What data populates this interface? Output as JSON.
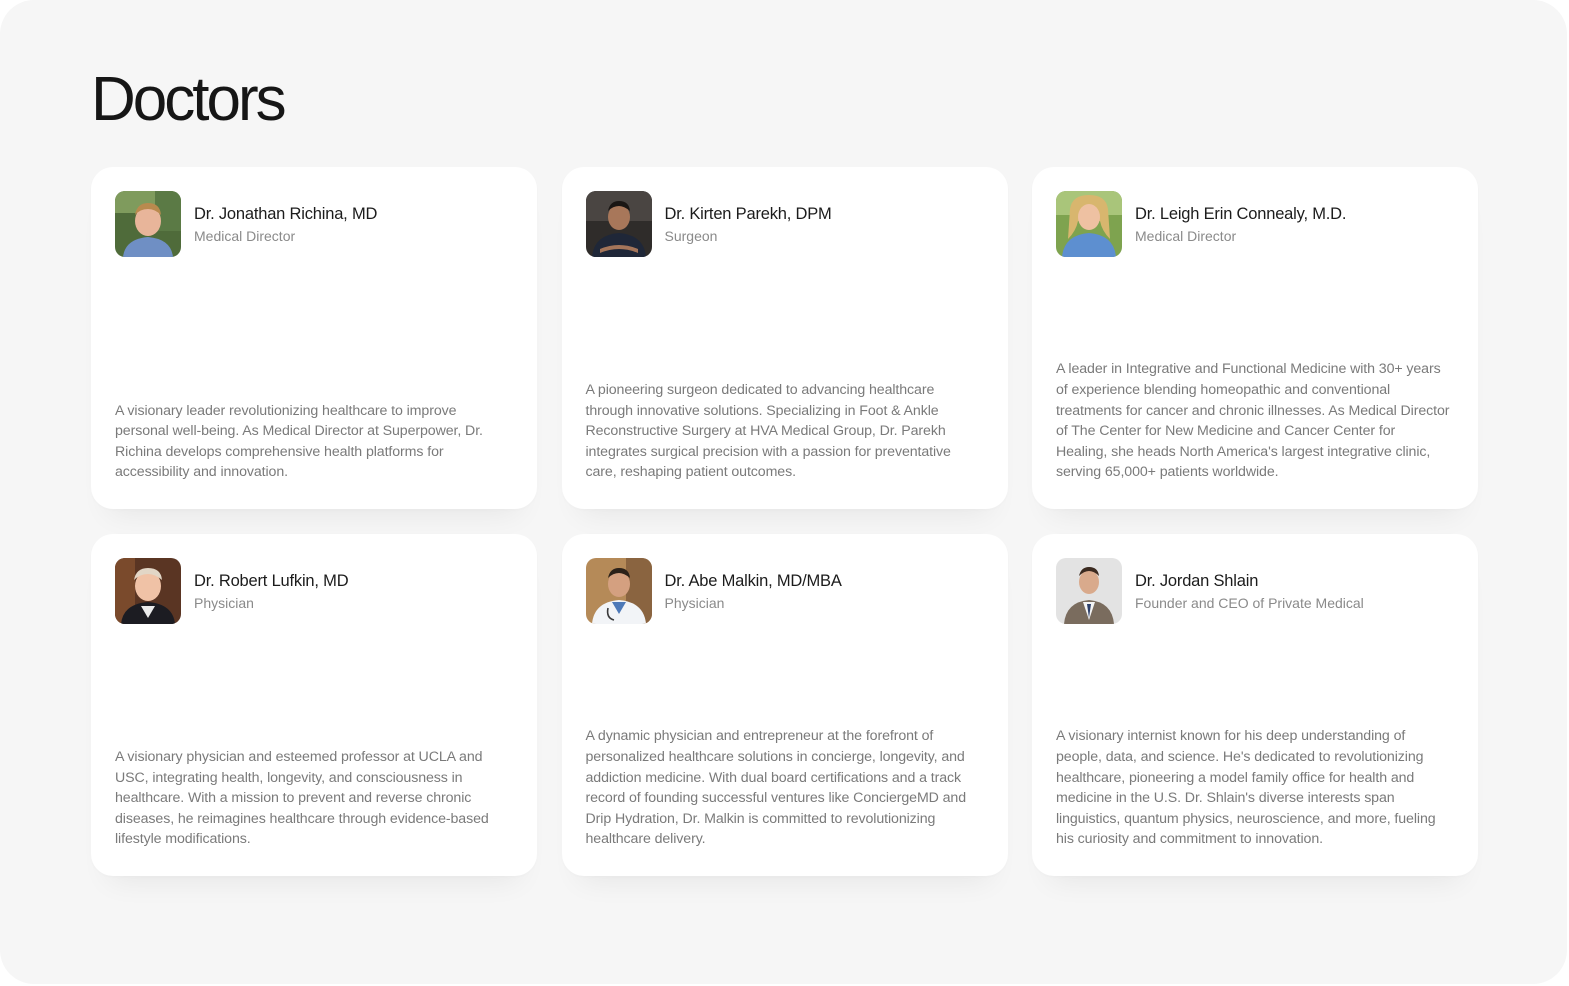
{
  "page": {
    "title": "Doctors"
  },
  "doctors": [
    {
      "name": "Dr. Jonathan Richina, MD",
      "role": "Medical Director",
      "bio": "A visionary leader revolutionizing healthcare to improve personal well-being. As Medical Director at Superpower, Dr. Richina develops comprehensive health platforms for accessibility and innovation."
    },
    {
      "name": "Dr. Kirten Parekh, DPM",
      "role": "Surgeon",
      "bio": "A pioneering surgeon dedicated to advancing healthcare through innovative solutions. Specializing in Foot & Ankle Reconstructive Surgery at HVA Medical Group, Dr. Parekh integrates surgical precision with a passion for preventative care, reshaping patient outcomes."
    },
    {
      "name": "Dr. Leigh Erin Connealy, M.D.",
      "role": "Medical Director",
      "bio": "A leader in Integrative and Functional Medicine with 30+ years of experience blending homeopathic and conventional treatments for cancer and chronic illnesses. As Medical Director of The Center for New Medicine and Cancer Center for Healing, she heads North America's largest integrative clinic, serving 65,000+ patients worldwide."
    },
    {
      "name": "Dr. Robert Lufkin, MD",
      "role": "Physician",
      "bio": "A visionary physician and esteemed professor at UCLA and USC, integrating health, longevity, and consciousness in healthcare. With a mission to prevent and reverse chronic diseases, he reimagines healthcare through evidence-based lifestyle modifications."
    },
    {
      "name": "Dr. Abe Malkin, MD/MBA",
      "role": "Physician",
      "bio": "A dynamic physician and entrepreneur at the forefront of personalized healthcare solutions in concierge, longevity, and addiction medicine. With dual board certifications and a track record of founding successful ventures like ConciergeMD and Drip Hydration, Dr. Malkin is committed to revolutionizing healthcare delivery."
    },
    {
      "name": "Dr. Jordan Shlain",
      "role": "Founder and CEO of Private Medical",
      "bio": "A visionary internist known for his deep understanding of people, data, and science. He's dedicated to revolutionizing healthcare, pioneering a model family office for health and medicine in the U.S. Dr. Shlain's diverse interests span linguistics, quantum physics, neuroscience, and more, fueling his curiosity and commitment to innovation."
    }
  ]
}
